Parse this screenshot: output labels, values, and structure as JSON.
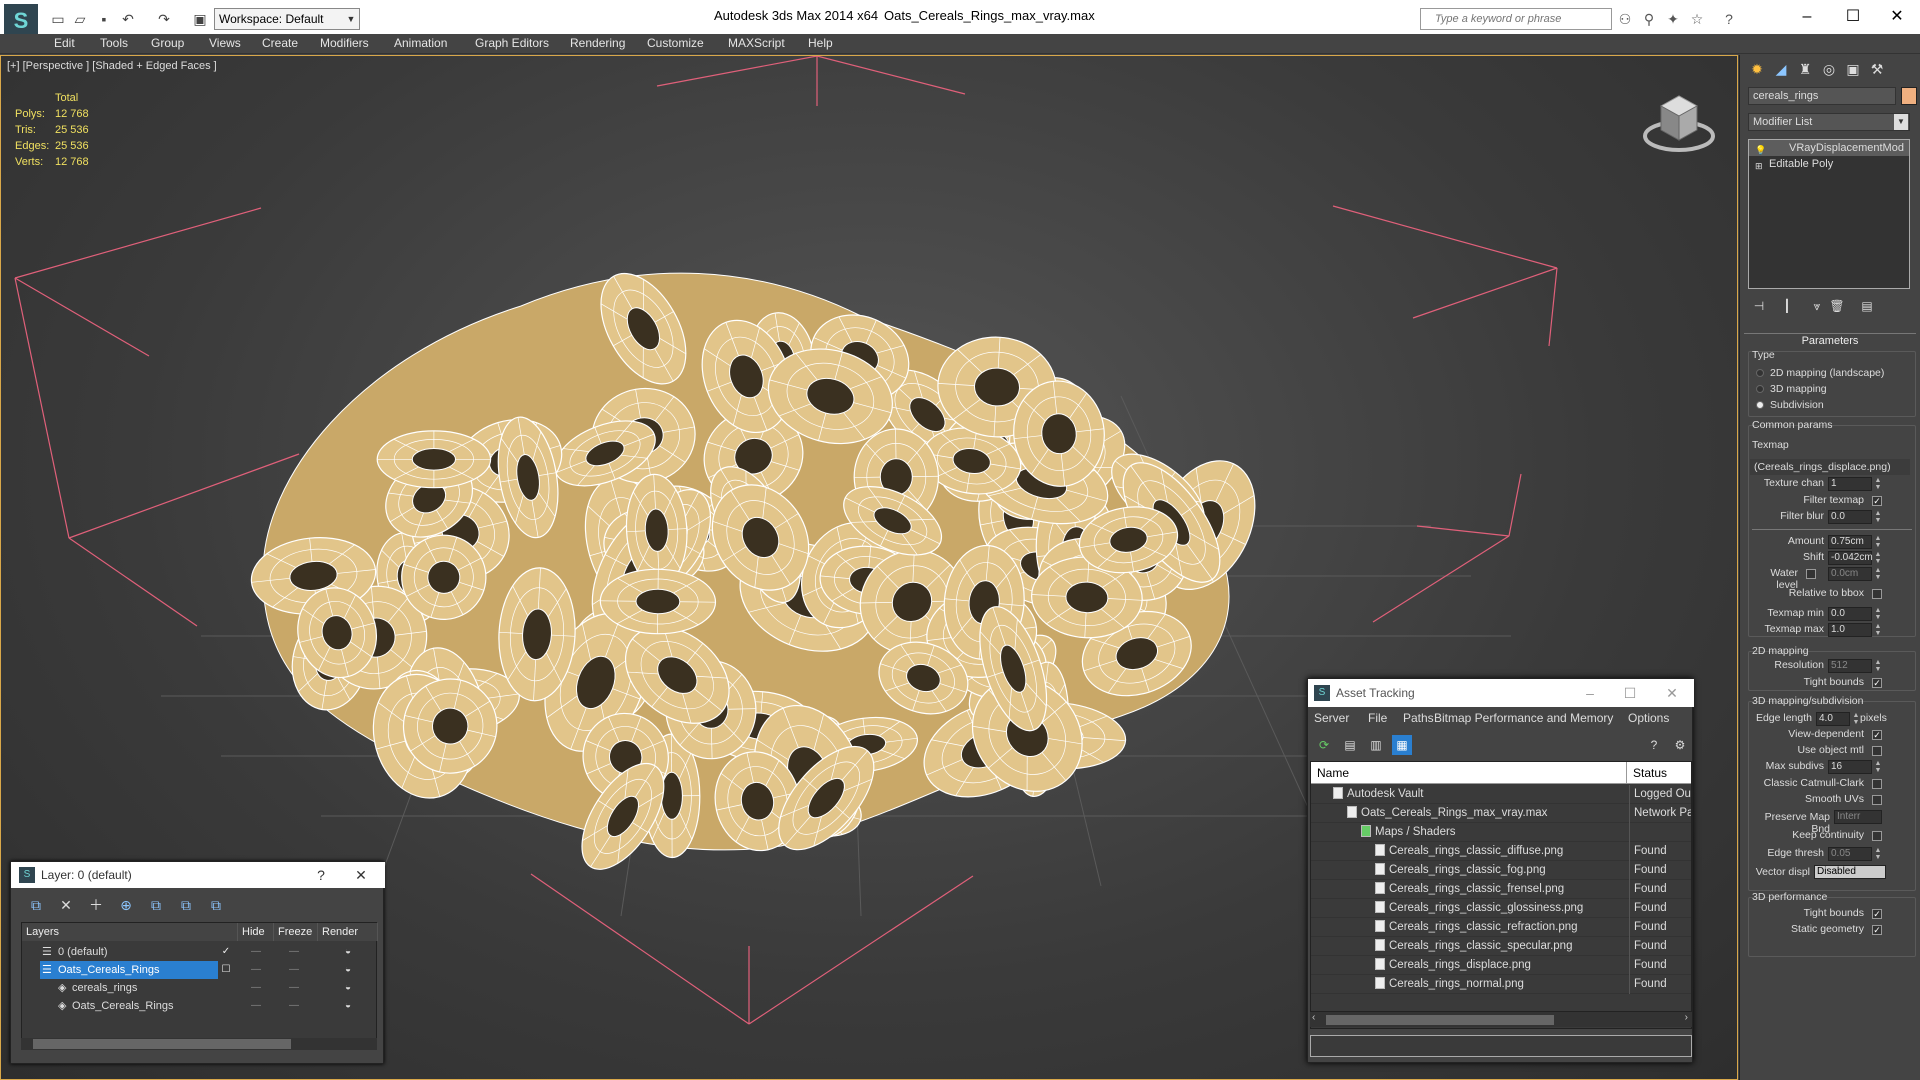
{
  "titlebar": {
    "workspace": "Workspace: Default",
    "app_title": "Autodesk 3ds Max  2014 x64",
    "file_title": "Oats_Cereals_Rings_max_vray.max",
    "search_placeholder": "Type a keyword or phrase"
  },
  "menu": [
    "Edit",
    "Tools",
    "Group",
    "Views",
    "Create",
    "Modifiers",
    "Animation",
    "Graph Editors",
    "Rendering",
    "Customize",
    "MAXScript",
    "Help"
  ],
  "viewport": {
    "label": "[+] [Perspective ] [Shaded + Edged Faces ]",
    "stats": {
      "header": "Total",
      "rows": [
        {
          "label": "Polys:",
          "value": "12 768"
        },
        {
          "label": "Tris:",
          "value": "25 536"
        },
        {
          "label": "Edges:",
          "value": "25 536"
        },
        {
          "label": "Verts:",
          "value": "12 768"
        }
      ]
    }
  },
  "command_panel": {
    "object_name": "cereals_rings",
    "modifier_list": "Modifier List",
    "stack": [
      "VRayDisplacementMod",
      "Editable Poly"
    ],
    "rollout": "Parameters",
    "type_label": "Type",
    "type_options": [
      "2D mapping (landscape)",
      "3D mapping",
      "Subdivision"
    ],
    "type_selected": 2,
    "common_params": "Common params",
    "texmap_label": "Texmap",
    "texmap_value": "(Cereals_rings_displace.png)",
    "texture_chan_label": "Texture chan",
    "texture_chan": "1",
    "filter_texmap_label": "Filter texmap",
    "filter_blur_label": "Filter blur",
    "filter_blur": "0.0",
    "amount_label": "Amount",
    "amount": "0.75cm",
    "shift_label": "Shift",
    "shift": "-0.042cm",
    "water_level_label": "Water level",
    "water_level": "0.0cm",
    "relative_bbox_label": "Relative to bbox",
    "texmap_min_label": "Texmap min",
    "texmap_min": "0.0",
    "texmap_max_label": "Texmap max",
    "texmap_max": "1.0",
    "mapping2d_label": "2D mapping",
    "resolution_label": "Resolution",
    "resolution": "512",
    "tight_bounds_label": "Tight bounds",
    "mapping3d_label": "3D mapping/subdivision",
    "edge_length_label": "Edge length",
    "edge_length": "4.0",
    "pixels_label": "pixels",
    "view_dependent_label": "View-dependent",
    "use_object_mtl_label": "Use object mtl",
    "max_subdivs_label": "Max subdivs",
    "max_subdivs": "16",
    "catmull_label": "Classic Catmull-Clark",
    "smooth_uvs_label": "Smooth UVs",
    "preserve_map_label": "Preserve Map Bnd",
    "preserve_map_value": "Interr",
    "keep_continuity_label": "Keep continuity",
    "edge_thresh_label": "Edge thresh",
    "edge_thresh": "0.05",
    "vector_displ_label": "Vector displ",
    "vector_displ_value": "Disabled",
    "perf_label": "3D performance",
    "perf_tight_bounds_label": "Tight bounds",
    "static_geometry_label": "Static geometry"
  },
  "layer_window": {
    "title": "Layer: 0 (default)",
    "columns": [
      "Layers",
      "Hide",
      "Freeze",
      "Render"
    ],
    "rows": [
      {
        "name": "0 (default)",
        "indent": 0
      },
      {
        "name": "Oats_Cereals_Rings",
        "indent": 0,
        "selected": true
      },
      {
        "name": "cereals_rings",
        "indent": 1
      },
      {
        "name": "Oats_Cereals_Rings",
        "indent": 1
      }
    ]
  },
  "asset_window": {
    "title": "Asset Tracking",
    "menu": [
      "Server",
      "File",
      "Paths",
      "Bitmap Performance and Memory",
      "Options"
    ],
    "columns": [
      "Name",
      "Status"
    ],
    "rows": [
      {
        "name": "Autodesk Vault",
        "status": "Logged Ou",
        "indent": 1
      },
      {
        "name": "Oats_Cereals_Rings_max_vray.max",
        "status": "Network Pa",
        "indent": 2
      },
      {
        "name": "Maps / Shaders",
        "status": "",
        "indent": 3
      },
      {
        "name": "Cereals_rings_classic_diffuse.png",
        "status": "Found",
        "indent": 4
      },
      {
        "name": "Cereals_rings_classic_fog.png",
        "status": "Found",
        "indent": 4
      },
      {
        "name": "Cereals_rings_classic_frensel.png",
        "status": "Found",
        "indent": 4
      },
      {
        "name": "Cereals_rings_classic_glossiness.png",
        "status": "Found",
        "indent": 4
      },
      {
        "name": "Cereals_rings_classic_refraction.png",
        "status": "Found",
        "indent": 4
      },
      {
        "name": "Cereals_rings_classic_specular.png",
        "status": "Found",
        "indent": 4
      },
      {
        "name": "Cereals_rings_displace.png",
        "status": "Found",
        "indent": 4
      },
      {
        "name": "Cereals_rings_normal.png",
        "status": "Found",
        "indent": 4
      }
    ]
  },
  "colors": {
    "accent": "#2a7fd0",
    "viewport_border": "#d9a84a",
    "stats_text": "#f0e060",
    "cereal": "#e2c58a",
    "bbox_lines": "#e0607a"
  }
}
